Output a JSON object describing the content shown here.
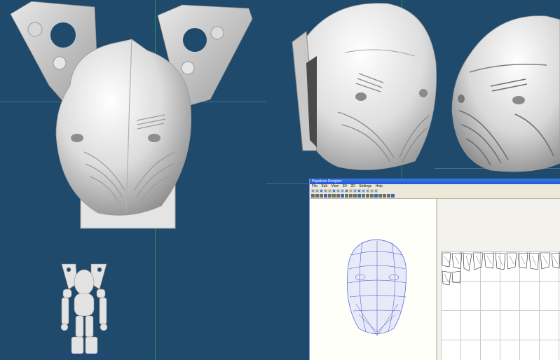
{
  "scene": {
    "background_color": "#1f4a6c",
    "guide_color": "#2fae4e",
    "models": [
      {
        "name": "helmet-with-shoulder-mounts"
      },
      {
        "name": "helmet-front"
      },
      {
        "name": "helmet-side"
      },
      {
        "name": "robot-figure"
      }
    ]
  },
  "app_window": {
    "title": "Pepakura Designer",
    "menu": [
      "File",
      "Edit",
      "View",
      "3D",
      "2D",
      "Settings",
      "Help"
    ],
    "toolbar_icons": [
      "new-icon",
      "open-icon",
      "save-icon",
      "print-icon",
      "zoom-icon",
      "rotate-icon",
      "unfold-icon",
      "select-icon"
    ],
    "title_bar_color": "#1f56d4"
  }
}
